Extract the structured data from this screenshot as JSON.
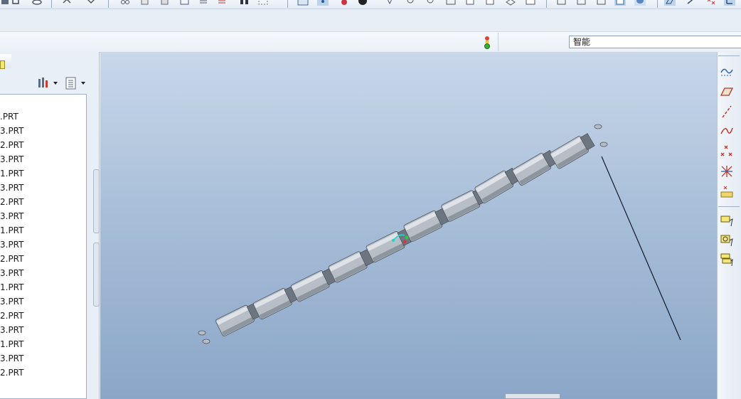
{
  "filter": {
    "value": "智能"
  },
  "model_tree": {
    "items": [
      ".PRT",
      "3.PRT",
      "2.PRT",
      "3.PRT",
      "1.PRT",
      "3.PRT",
      "2.PRT",
      "3.PRT",
      "1.PRT",
      "3.PRT",
      "2.PRT",
      "3.PRT",
      "1.PRT",
      "3.PRT",
      "2.PRT",
      "3.PRT",
      "1.PRT",
      "3.PRT",
      "2.PRT"
    ]
  },
  "icons": {
    "top_toolbar": [
      "save-icon",
      "undo-icon",
      "redo-icon",
      "cut-icon",
      "copy-icon",
      "paste-icon",
      "regenerate-icon",
      "find-icon",
      "select-box-icon",
      "repaint-icon",
      "orient-icon",
      "spin-center-icon",
      "appearance-icon",
      "zoom-in-icon",
      "zoom-out-icon",
      "refit-icon",
      "reorient-icon",
      "saved-views-icon",
      "layers-icon",
      "view-manager-icon",
      "wireframe-icon",
      "hidden-line-icon",
      "no-hidden-icon",
      "shaded-icon",
      "enhanced-realism-icon",
      "datum-planes-icon",
      "datum-axes-icon",
      "datum-points-icon",
      "coordinate-systems-icon"
    ],
    "right_toolbar": [
      "sketch-curve-icon",
      "datum-plane-icon",
      "datum-axis-icon",
      "datum-curve-icon",
      "datum-point-icon",
      "coordinate-system-icon",
      "analysis-feature-icon",
      "annotation-icon",
      "component-annotation-icon",
      "feature-annotation-icon"
    ]
  },
  "colors": {
    "viewport_top": "#c9d8ea",
    "viewport_bottom": "#8ba6c8",
    "part_fill": "#b7bec6",
    "status_green": "#33b233"
  }
}
